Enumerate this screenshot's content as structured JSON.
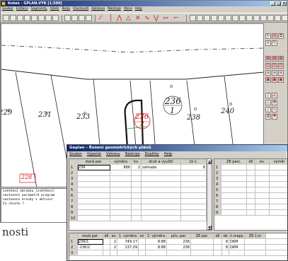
{
  "main_window": {
    "title": "Kokeš - GPLAN.VYK [1:500]",
    "title_buttons": [
      "_",
      "□",
      "×"
    ],
    "menu": [
      "Soubor",
      "Editace",
      "Segmenty",
      "Výběr",
      "Body",
      "Vlastnosti",
      "Aplikace",
      "Nástroje",
      "Okno",
      "Help"
    ],
    "toolbar_icons": [
      "new-file-icon",
      "open-icon",
      "save-icon",
      "copy-icon",
      "print-icon",
      "undo-icon",
      "redo-icon",
      "layers-icon",
      "color-icon",
      "line-tool-icon",
      "polyline-tool-icon",
      "arc-tool-icon",
      "text-tool-icon",
      "measure-icon"
    ]
  },
  "canvas": {
    "parcels": [
      {
        "label": "229",
        "circled": false
      },
      {
        "label": "231",
        "circled": false
      },
      {
        "label": "233",
        "circled": false
      },
      {
        "label": "236",
        "sublabel": "1",
        "circled": true
      },
      {
        "label": "236",
        "sublabel": "2",
        "circled": true,
        "highlight": true
      },
      {
        "label": "238",
        "circled": false
      },
      {
        "label": "240",
        "circled": false
      },
      {
        "label": "228",
        "circled": false,
        "boxed": true
      }
    ],
    "colors": {
      "boundary": "#222222",
      "highlight": "#d01818",
      "dashed": "#333333"
    }
  },
  "console": {
    "lines": [
      "zvětšení obrázku [zvětšení]",
      "nastavení parametrů program",
      "nastavení kresby v aktivní",
      "Co chcete ?"
    ]
  },
  "background_text": "nosti",
  "geplan": {
    "title": "Geplan - Řešení geometrických plánů",
    "menu": [
      "Soubor",
      "Výpočet",
      "Výkresy",
      "Nástroje",
      "Doplňky",
      "Help"
    ],
    "left_grid": {
      "headers": [
        "stará par.",
        "výměra",
        "kv.",
        "druh a využití",
        "LV č."
      ],
      "rows": [
        [
          "236",
          "886",
          "2",
          "zahrada",
          "8"
        ],
        [
          "",
          "",
          "",
          "",
          ""
        ],
        [
          "",
          "",
          "",
          "",
          ""
        ],
        [
          "",
          "",
          "",
          "",
          ""
        ],
        [
          "",
          "",
          "",
          "",
          ""
        ],
        [
          "",
          "",
          "",
          "",
          ""
        ],
        [
          "",
          "",
          "",
          "",
          ""
        ],
        [
          "",
          "",
          "",
          "",
          ""
        ],
        [
          "",
          "",
          "",
          "",
          ""
        ],
        [
          "",
          "",
          "",
          "",
          ""
        ]
      ],
      "row_numbers": [
        "1",
        "2",
        "3",
        "4",
        "5",
        "6",
        "7",
        "8",
        "9",
        "10"
      ]
    },
    "right_grid": {
      "headers": [
        "",
        "ZE parc.",
        "díl",
        "ev.",
        "výměr"
      ],
      "row_numbers": [
        "1",
        "2",
        "3",
        "4",
        "5",
        "6",
        "7",
        "8",
        "9"
      ]
    },
    "bottom_grid": {
      "headers": [
        "nová par.",
        "díl",
        "so",
        "1. výměra",
        "so",
        "2. výměra",
        "pův. par.",
        "ZE par.",
        "díl",
        "ob",
        "č.mapy",
        "ZE č.m"
      ],
      "rows": [
        [
          "236/1",
          "",
          "2",
          "749.17",
          "",
          "8.88",
          "236",
          "",
          "",
          "8",
          "DKM",
          ""
        ],
        [
          "-236/2",
          "",
          "2",
          "137.29",
          "",
          "8.88",
          "236",
          "",
          "",
          "8",
          "DKM",
          ""
        ]
      ],
      "row_numbers": [
        "1",
        "2",
        "3"
      ]
    }
  }
}
